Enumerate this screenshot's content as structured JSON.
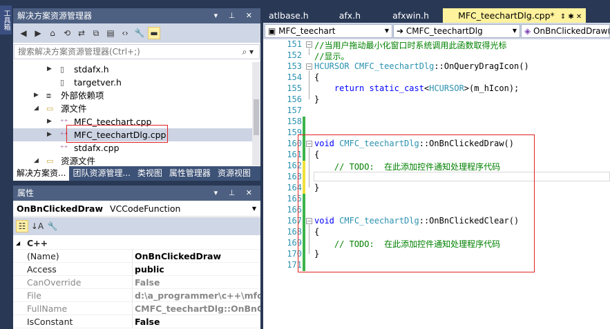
{
  "toolbox": {
    "label": "工具箱"
  },
  "solution_explorer": {
    "title": "解决方案资源管理器",
    "search_placeholder": "搜索解决方案资源管理器(Ctrl+;)",
    "tree": [
      {
        "label": "stdafx.h",
        "icon": "header-file-icon",
        "expander": "▶"
      },
      {
        "label": "targetver.h",
        "icon": "header-file-icon",
        "expander": ""
      },
      {
        "label": "外部依赖项",
        "icon": "dependencies-icon",
        "expander": "▶"
      },
      {
        "label": "源文件",
        "icon": "folder-icon",
        "expander": "◢"
      },
      {
        "label": "MFC_teechart.cpp",
        "icon": "cpp-file-icon",
        "expander": "▶"
      },
      {
        "label": "MFC_teechartDlg.cpp",
        "icon": "cpp-file-icon",
        "expander": "▶"
      },
      {
        "label": "stdafx.cpp",
        "icon": "cpp-file-icon",
        "expander": ""
      },
      {
        "label": "资源文件",
        "icon": "folder-icon",
        "expander": "◢"
      }
    ],
    "bottom_tabs": [
      "解决方案资...",
      "团队资源管理...",
      "类视图",
      "属性管理器",
      "资源视图"
    ]
  },
  "properties": {
    "title": "属性",
    "object_name": "OnBnClickedDraw",
    "object_type": "VCCodeFunction",
    "category": "C++",
    "rows": [
      {
        "name": "(Name)",
        "value": "OnBnClickedDraw"
      },
      {
        "name": "Access",
        "value": "public"
      },
      {
        "name": "CanOverride",
        "value": "False"
      },
      {
        "name": "File",
        "value": "d:\\a_programmer\\c++\\mfc_te"
      },
      {
        "name": "FullName",
        "value": "CMFC_teechartDlg::OnBnClicke"
      },
      {
        "name": "IsConstant",
        "value": "False"
      }
    ]
  },
  "editor": {
    "tabs": [
      "atlbase.h",
      "afx.h",
      "afxwin.h",
      "MFC_teechartDlg.cpp*"
    ],
    "tab_icons": "⇕ ✱ ✕",
    "nav": {
      "project": "MFC_teechart",
      "class": "CMFC_teechartDlg",
      "member": "OnBnClickedDraw()"
    },
    "lines": [
      {
        "num": "151",
        "tokens": [
          {
            "t": "//当用户拖动最小化窗口时系统调用此函数取得光标",
            "c": "cm"
          }
        ]
      },
      {
        "num": "152",
        "tokens": [
          {
            "t": "//显示。",
            "c": "cm"
          }
        ]
      },
      {
        "num": "153",
        "tokens": [
          {
            "t": "HCURSOR",
            "c": "ty"
          },
          {
            "t": " "
          },
          {
            "t": "CMFC_teechartDlg",
            "c": "ty"
          },
          {
            "t": "::OnQueryDragIcon()"
          }
        ]
      },
      {
        "num": "154",
        "tokens": [
          {
            "t": "{"
          }
        ]
      },
      {
        "num": "155",
        "tokens": [
          {
            "t": "    "
          },
          {
            "t": "return",
            "c": "kw"
          },
          {
            "t": " "
          },
          {
            "t": "static_cast",
            "c": "kw"
          },
          {
            "t": "<"
          },
          {
            "t": "HCURSOR",
            "c": "ty"
          },
          {
            "t": ">(m_hIcon);"
          }
        ]
      },
      {
        "num": "156",
        "tokens": [
          {
            "t": "}"
          }
        ]
      },
      {
        "num": "157",
        "tokens": []
      },
      {
        "num": "158",
        "tokens": []
      },
      {
        "num": "159",
        "tokens": []
      },
      {
        "num": "160",
        "tokens": [
          {
            "t": "void",
            "c": "kw"
          },
          {
            "t": " "
          },
          {
            "t": "CMFC_teechartDlg",
            "c": "ty"
          },
          {
            "t": "::OnBnClickedDraw()"
          }
        ]
      },
      {
        "num": "161",
        "tokens": [
          {
            "t": "{"
          }
        ]
      },
      {
        "num": "162",
        "tokens": [
          {
            "t": "    // TODO:  在此添加控件通知处理程序代码",
            "c": "cm"
          }
        ]
      },
      {
        "num": "163",
        "tokens": []
      },
      {
        "num": "164",
        "tokens": [
          {
            "t": "}"
          }
        ]
      },
      {
        "num": "165",
        "tokens": []
      },
      {
        "num": "166",
        "tokens": []
      },
      {
        "num": "167",
        "tokens": [
          {
            "t": "void",
            "c": "kw"
          },
          {
            "t": " "
          },
          {
            "t": "CMFC_teechartDlg",
            "c": "ty"
          },
          {
            "t": "::OnBnClickedClear()"
          }
        ]
      },
      {
        "num": "168",
        "tokens": [
          {
            "t": "{"
          }
        ]
      },
      {
        "num": "169",
        "tokens": [
          {
            "t": "    // TODO:  在此添加控件通知处理程序代码",
            "c": "cm"
          }
        ]
      },
      {
        "num": "170",
        "tokens": [
          {
            "t": "}"
          }
        ]
      },
      {
        "num": "171",
        "tokens": []
      }
    ]
  },
  "colors": {
    "chrome_bg": "#293955",
    "active_doc_tab": "#fff29d",
    "change_saved": "#3cb44a",
    "change_unsaved": "#f1e03b",
    "highlight_box": "#e02020"
  }
}
